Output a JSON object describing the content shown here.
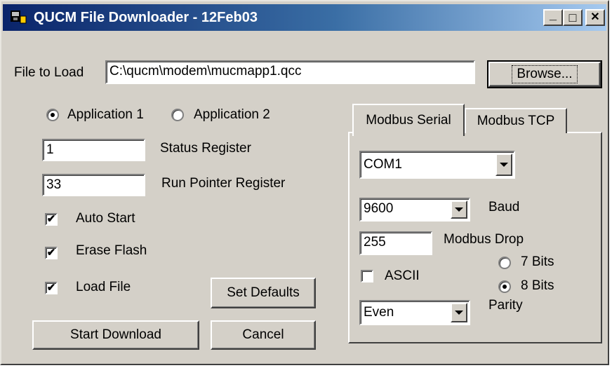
{
  "window": {
    "title": "QUCM File Downloader - 12Feb03",
    "controls": {
      "minimize": "_",
      "maximize": "□",
      "close": "✕"
    },
    "colors": {
      "title_start": "#0a246a",
      "title_end": "#a6caf0",
      "face": "#d4d0c8"
    }
  },
  "file": {
    "label": "File to Load",
    "value": "C:\\qucm\\modem\\mucmapp1.qcc",
    "browse_label": "Browse..."
  },
  "application": {
    "options": [
      {
        "label": "Application 1",
        "selected": true
      },
      {
        "label": "Application 2",
        "selected": false
      }
    ]
  },
  "registers": {
    "status_value": "1",
    "status_label": "Status Register",
    "run_pointer_value": "33",
    "run_pointer_label": "Run Pointer Register"
  },
  "options": {
    "auto_start": {
      "label": "Auto Start",
      "checked": true
    },
    "erase_flash": {
      "label": "Erase Flash",
      "checked": true
    },
    "load_file": {
      "label": "Load File",
      "checked": true
    }
  },
  "buttons": {
    "set_defaults": "Set Defaults",
    "start_download": "Start Download",
    "cancel": "Cancel"
  },
  "tabs": [
    {
      "label": "Modbus Serial",
      "active": true
    },
    {
      "label": "Modbus TCP",
      "active": false
    }
  ],
  "serial": {
    "port_value": "COM1",
    "baud_value": "9600",
    "baud_label": "Baud",
    "drop_value": "255",
    "drop_label": "Modbus Drop",
    "ascii": {
      "label": "ASCII",
      "checked": false
    },
    "bits": [
      {
        "label": "7 Bits",
        "selected": false
      },
      {
        "label": "8 Bits",
        "selected": true
      }
    ],
    "parity_value": "Even",
    "parity_label": "Parity"
  },
  "icons": {
    "app": "app-icon",
    "dropdown": "chevron-down-icon",
    "check": "checkmark-icon"
  }
}
